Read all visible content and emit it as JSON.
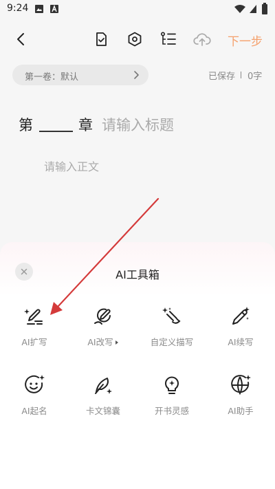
{
  "status_bar": {
    "time": "9:24"
  },
  "toolbar": {
    "next_label": "下一步"
  },
  "volume": {
    "label": "第一卷：默认"
  },
  "save_info": {
    "saved": "已保存",
    "word_count": "0字"
  },
  "chapter": {
    "prefix": "第",
    "suffix": "章",
    "title_placeholder": "请输入标题"
  },
  "body": {
    "placeholder": "请输入正文"
  },
  "ai_panel": {
    "title": "AI工具箱",
    "tools": [
      {
        "label": "AI扩写",
        "icon": "pen-lines-sparkle-icon"
      },
      {
        "label": "AI改写",
        "icon": "pen-loop-icon"
      },
      {
        "label": "自定义描写",
        "icon": "brush-stroke-icon"
      },
      {
        "label": "AI续写",
        "icon": "magic-pen-icon"
      },
      {
        "label": "AI起名",
        "icon": "smile-face-sparkle-icon"
      },
      {
        "label": "卡文锦囊",
        "icon": "feather-icon"
      },
      {
        "label": "开书灵感",
        "icon": "lightbulb-icon"
      },
      {
        "label": "AI助手",
        "icon": "globe-sparkle-icon"
      }
    ]
  },
  "colors": {
    "accent": "#f5a06b",
    "annotation_arrow": "#d43a3a"
  }
}
